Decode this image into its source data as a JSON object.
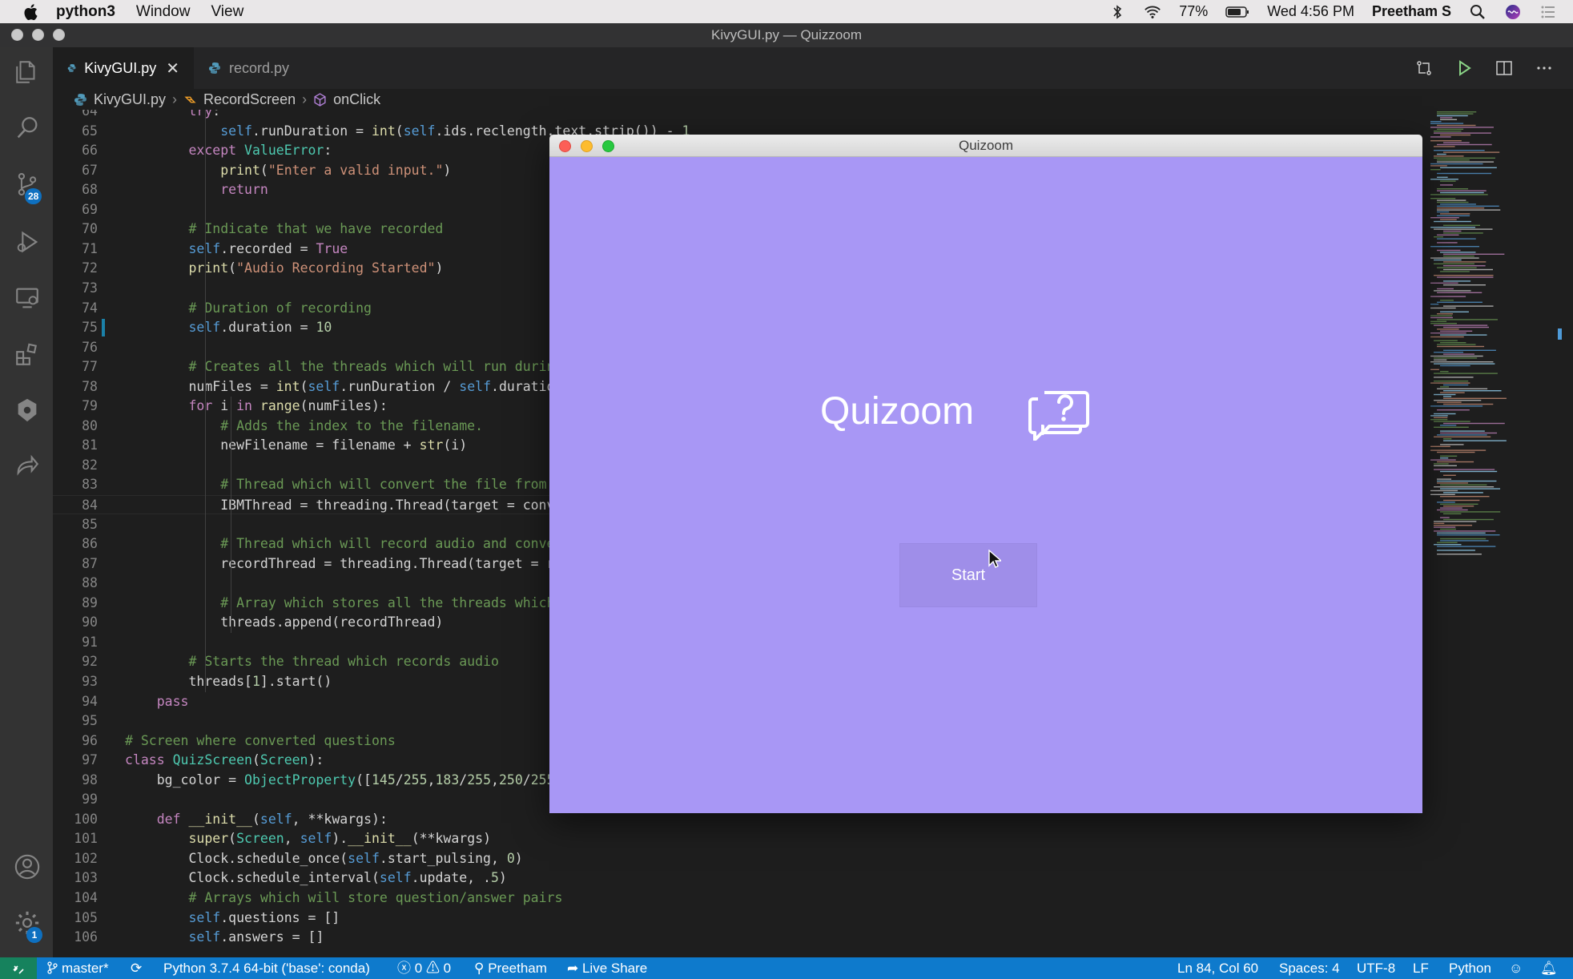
{
  "menubar": {
    "app": "python3",
    "items": [
      "Window",
      "View"
    ],
    "battery": "77%",
    "clock": "Wed 4:56 PM",
    "user": "Preetham S"
  },
  "window": {
    "title": "KivyGUI.py — Quizzoom"
  },
  "activity_bar": {
    "scm_badge": "28",
    "settings_badge": "1"
  },
  "tabs": [
    {
      "label": "KivyGUI.py",
      "close": "✕"
    },
    {
      "label": "record.py"
    }
  ],
  "breadcrumb": {
    "file": "KivyGUI.py",
    "class": "RecordScreen",
    "method": "onClick"
  },
  "editor": {
    "lines": [
      {
        "n": "64",
        "code": "        try:"
      },
      {
        "n": "65",
        "code": "            self.runDuration = int(self.ids.reclength.text.strip()) - 1"
      },
      {
        "n": "66",
        "code": "        except ValueError:"
      },
      {
        "n": "67",
        "code": "            print(\"Enter a valid input.\")"
      },
      {
        "n": "68",
        "code": "            return"
      },
      {
        "n": "69",
        "code": ""
      },
      {
        "n": "70",
        "code": "        # Indicate that we have recorded"
      },
      {
        "n": "71",
        "code": "        self.recorded = True"
      },
      {
        "n": "72",
        "code": "        print(\"Audio Recording Started\")"
      },
      {
        "n": "73",
        "code": ""
      },
      {
        "n": "74",
        "code": "        # Duration of recording"
      },
      {
        "n": "75",
        "code": "        self.duration = 10"
      },
      {
        "n": "76",
        "code": ""
      },
      {
        "n": "77",
        "code": "        # Creates all the threads which will run during"
      },
      {
        "n": "78",
        "code": "        numFiles = int(self.runDuration / self.duration"
      },
      {
        "n": "79",
        "code": "        for i in range(numFiles):"
      },
      {
        "n": "80",
        "code": "            # Adds the index to the filename."
      },
      {
        "n": "81",
        "code": "            newFilename = filename + str(i)"
      },
      {
        "n": "82",
        "code": ""
      },
      {
        "n": "83",
        "code": "            # Thread which will convert the file from"
      },
      {
        "n": "84",
        "code": "            IBMThread = threading.Thread(target = conv"
      },
      {
        "n": "85",
        "code": ""
      },
      {
        "n": "86",
        "code": "            # Thread which will record audio and conve"
      },
      {
        "n": "87",
        "code": "            recordThread = threading.Thread(target = r"
      },
      {
        "n": "88",
        "code": ""
      },
      {
        "n": "89",
        "code": "            # Array which stores all the threads which"
      },
      {
        "n": "90",
        "code": "            threads.append(recordThread)"
      },
      {
        "n": "91",
        "code": ""
      },
      {
        "n": "92",
        "code": "        # Starts the thread which records audio"
      },
      {
        "n": "93",
        "code": "        threads[1].start()"
      },
      {
        "n": "94",
        "code": "    pass"
      },
      {
        "n": "95",
        "code": ""
      },
      {
        "n": "96",
        "code": "# Screen where converted questions"
      },
      {
        "n": "97",
        "code": "class QuizScreen(Screen):"
      },
      {
        "n": "98",
        "code": "    bg_color = ObjectProperty([145/255,183/255,250/255"
      },
      {
        "n": "99",
        "code": ""
      },
      {
        "n": "100",
        "code": "    def __init__(self, **kwargs):"
      },
      {
        "n": "101",
        "code": "        super(Screen, self).__init__(**kwargs)"
      },
      {
        "n": "102",
        "code": "        Clock.schedule_once(self.start_pulsing, 0)"
      },
      {
        "n": "103",
        "code": "        Clock.schedule_interval(self.update, .5)"
      },
      {
        "n": "104",
        "code": "        # Arrays which will store question/answer pairs"
      },
      {
        "n": "105",
        "code": "        self.questions = []"
      },
      {
        "n": "106",
        "code": "        self.answers = []"
      }
    ]
  },
  "kivy_app": {
    "window_title": "Quizoom",
    "app_name": "Quizoom",
    "start_label": "Start",
    "bg_color": "#a897f5"
  },
  "statusbar": {
    "branch": "master*",
    "interpreter": "Python 3.7.4 64-bit ('base': conda)",
    "errors": "0",
    "warnings": "0",
    "liveshare_user": "Preetham",
    "liveshare": "Live Share",
    "position": "Ln 84, Col 60",
    "spaces": "Spaces: 4",
    "encoding": "UTF-8",
    "eol": "LF",
    "language": "Python"
  },
  "colors": {
    "keyword": "#c586c0",
    "function": "#dcdcaa",
    "string": "#ce9178",
    "comment": "#6a9955",
    "self": "#569cd6",
    "class": "#4ec9b0",
    "accent_status": "#0e7acc"
  }
}
